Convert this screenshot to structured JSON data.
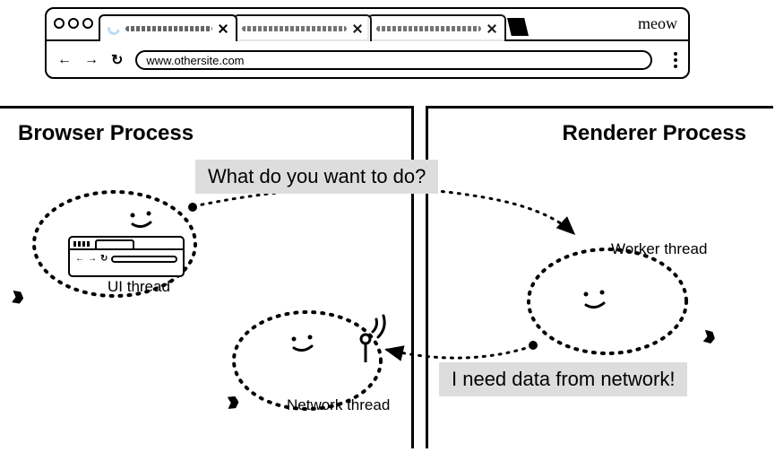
{
  "browser": {
    "url": "www.othersite.com",
    "brand": "meow"
  },
  "boxes": {
    "left_title": "Browser Process",
    "right_title": "Renderer Process"
  },
  "speech": {
    "q": "What do you want to do?",
    "a": "I need data from network!"
  },
  "threads": {
    "ui": "UI thread",
    "network": "Network thread",
    "worker": "Worker thread"
  }
}
